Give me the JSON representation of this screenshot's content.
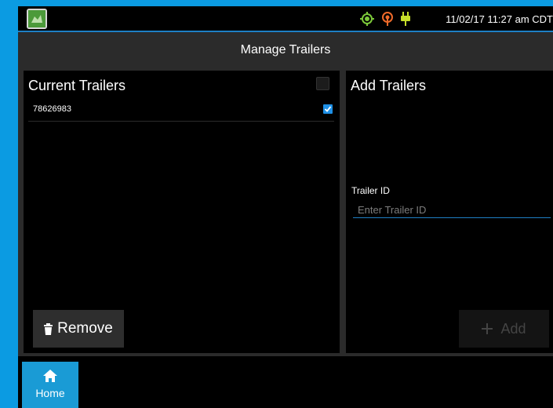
{
  "status_bar": {
    "datetime": "11/02/17 11:27 am CDT",
    "icons": [
      "gps-icon",
      "signal-icon",
      "power-plug-icon"
    ],
    "colors": {
      "gps": "#7cc93a",
      "signal": "#ef6a2a",
      "power": "#c7df2a"
    }
  },
  "header": {
    "title": "Manage Trailers"
  },
  "current_trailers": {
    "title": "Current Trailers",
    "items": [
      {
        "id": "78626983",
        "checked": true
      }
    ],
    "remove_label": "Remove"
  },
  "add_trailers": {
    "title": "Add Trailers",
    "field_label": "Trailer ID",
    "field_placeholder": "Enter Trailer ID",
    "add_label": "Add"
  },
  "nav": {
    "home_label": "Home"
  },
  "colors": {
    "accent": "#1a9bd5",
    "frame": "#0b9be2"
  }
}
